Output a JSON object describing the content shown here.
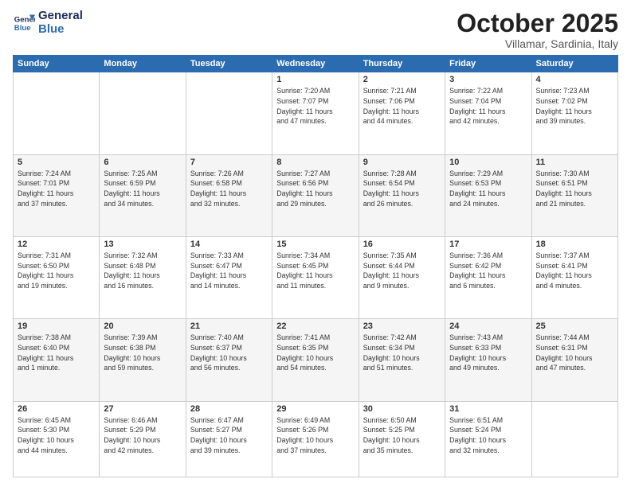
{
  "header": {
    "logo_line1": "General",
    "logo_line2": "Blue",
    "month": "October 2025",
    "location": "Villamar, Sardinia, Italy"
  },
  "weekdays": [
    "Sunday",
    "Monday",
    "Tuesday",
    "Wednesday",
    "Thursday",
    "Friday",
    "Saturday"
  ],
  "weeks": [
    [
      {
        "day": "",
        "info": ""
      },
      {
        "day": "",
        "info": ""
      },
      {
        "day": "",
        "info": ""
      },
      {
        "day": "1",
        "info": "Sunrise: 7:20 AM\nSunset: 7:07 PM\nDaylight: 11 hours\nand 47 minutes."
      },
      {
        "day": "2",
        "info": "Sunrise: 7:21 AM\nSunset: 7:06 PM\nDaylight: 11 hours\nand 44 minutes."
      },
      {
        "day": "3",
        "info": "Sunrise: 7:22 AM\nSunset: 7:04 PM\nDaylight: 11 hours\nand 42 minutes."
      },
      {
        "day": "4",
        "info": "Sunrise: 7:23 AM\nSunset: 7:02 PM\nDaylight: 11 hours\nand 39 minutes."
      }
    ],
    [
      {
        "day": "5",
        "info": "Sunrise: 7:24 AM\nSunset: 7:01 PM\nDaylight: 11 hours\nand 37 minutes."
      },
      {
        "day": "6",
        "info": "Sunrise: 7:25 AM\nSunset: 6:59 PM\nDaylight: 11 hours\nand 34 minutes."
      },
      {
        "day": "7",
        "info": "Sunrise: 7:26 AM\nSunset: 6:58 PM\nDaylight: 11 hours\nand 32 minutes."
      },
      {
        "day": "8",
        "info": "Sunrise: 7:27 AM\nSunset: 6:56 PM\nDaylight: 11 hours\nand 29 minutes."
      },
      {
        "day": "9",
        "info": "Sunrise: 7:28 AM\nSunset: 6:54 PM\nDaylight: 11 hours\nand 26 minutes."
      },
      {
        "day": "10",
        "info": "Sunrise: 7:29 AM\nSunset: 6:53 PM\nDaylight: 11 hours\nand 24 minutes."
      },
      {
        "day": "11",
        "info": "Sunrise: 7:30 AM\nSunset: 6:51 PM\nDaylight: 11 hours\nand 21 minutes."
      }
    ],
    [
      {
        "day": "12",
        "info": "Sunrise: 7:31 AM\nSunset: 6:50 PM\nDaylight: 11 hours\nand 19 minutes."
      },
      {
        "day": "13",
        "info": "Sunrise: 7:32 AM\nSunset: 6:48 PM\nDaylight: 11 hours\nand 16 minutes."
      },
      {
        "day": "14",
        "info": "Sunrise: 7:33 AM\nSunset: 6:47 PM\nDaylight: 11 hours\nand 14 minutes."
      },
      {
        "day": "15",
        "info": "Sunrise: 7:34 AM\nSunset: 6:45 PM\nDaylight: 11 hours\nand 11 minutes."
      },
      {
        "day": "16",
        "info": "Sunrise: 7:35 AM\nSunset: 6:44 PM\nDaylight: 11 hours\nand 9 minutes."
      },
      {
        "day": "17",
        "info": "Sunrise: 7:36 AM\nSunset: 6:42 PM\nDaylight: 11 hours\nand 6 minutes."
      },
      {
        "day": "18",
        "info": "Sunrise: 7:37 AM\nSunset: 6:41 PM\nDaylight: 11 hours\nand 4 minutes."
      }
    ],
    [
      {
        "day": "19",
        "info": "Sunrise: 7:38 AM\nSunset: 6:40 PM\nDaylight: 11 hours\nand 1 minute."
      },
      {
        "day": "20",
        "info": "Sunrise: 7:39 AM\nSunset: 6:38 PM\nDaylight: 10 hours\nand 59 minutes."
      },
      {
        "day": "21",
        "info": "Sunrise: 7:40 AM\nSunset: 6:37 PM\nDaylight: 10 hours\nand 56 minutes."
      },
      {
        "day": "22",
        "info": "Sunrise: 7:41 AM\nSunset: 6:35 PM\nDaylight: 10 hours\nand 54 minutes."
      },
      {
        "day": "23",
        "info": "Sunrise: 7:42 AM\nSunset: 6:34 PM\nDaylight: 10 hours\nand 51 minutes."
      },
      {
        "day": "24",
        "info": "Sunrise: 7:43 AM\nSunset: 6:33 PM\nDaylight: 10 hours\nand 49 minutes."
      },
      {
        "day": "25",
        "info": "Sunrise: 7:44 AM\nSunset: 6:31 PM\nDaylight: 10 hours\nand 47 minutes."
      }
    ],
    [
      {
        "day": "26",
        "info": "Sunrise: 6:45 AM\nSunset: 5:30 PM\nDaylight: 10 hours\nand 44 minutes."
      },
      {
        "day": "27",
        "info": "Sunrise: 6:46 AM\nSunset: 5:29 PM\nDaylight: 10 hours\nand 42 minutes."
      },
      {
        "day": "28",
        "info": "Sunrise: 6:47 AM\nSunset: 5:27 PM\nDaylight: 10 hours\nand 39 minutes."
      },
      {
        "day": "29",
        "info": "Sunrise: 6:49 AM\nSunset: 5:26 PM\nDaylight: 10 hours\nand 37 minutes."
      },
      {
        "day": "30",
        "info": "Sunrise: 6:50 AM\nSunset: 5:25 PM\nDaylight: 10 hours\nand 35 minutes."
      },
      {
        "day": "31",
        "info": "Sunrise: 6:51 AM\nSunset: 5:24 PM\nDaylight: 10 hours\nand 32 minutes."
      },
      {
        "day": "",
        "info": ""
      }
    ]
  ]
}
